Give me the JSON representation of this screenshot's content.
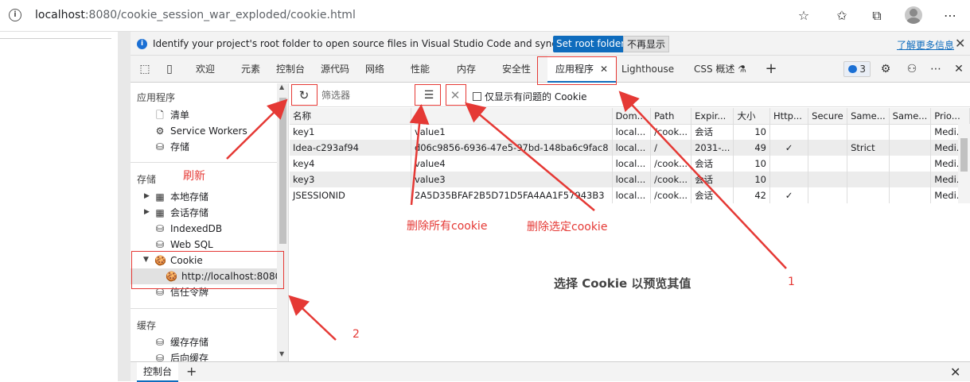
{
  "browser": {
    "url_host": "localhost",
    "url_path": ":8080/cookie_session_war_exploded/cookie.html"
  },
  "notice": {
    "text": "Identify your project's root folder to open source files in Visual Studio Code and sync changes.",
    "set_root_label": "Set root folder",
    "dismiss_label": "不再显示",
    "learn_more": "了解更多信息"
  },
  "tabs": {
    "welcome": "欢迎",
    "elements": "元素",
    "console": "控制台",
    "sources": "源代码",
    "network": "网络",
    "performance": "性能",
    "memory": "内存",
    "security": "安全性",
    "application": "应用程序",
    "lighthouse": "Lighthouse",
    "css_overview": "CSS 概述",
    "issues_count": "3"
  },
  "tree": {
    "app_section": "应用程序",
    "manifest": "清单",
    "service_workers": "Service Workers",
    "storage_item": "存储",
    "storage_section": "存储",
    "local_storage": "本地存储",
    "session_storage": "会话存储",
    "indexeddb": "IndexedDB",
    "websql": "Web SQL",
    "cookie": "Cookie",
    "cookie_origin": "http://localhost:8080",
    "trust_tokens": "信任令牌",
    "cache_section": "缓存",
    "cache_storage": "缓存存储",
    "back_forward_cache": "后向缓存"
  },
  "toolbar": {
    "filter_placeholder": "筛选器",
    "only_issues_label": "仅显示有问题的 Cookie"
  },
  "table": {
    "headers": [
      "名称",
      "值",
      "Dom...",
      "Path",
      "Expir...",
      "大小",
      "Http...",
      "Secure",
      "Same...",
      "Same...",
      "Prio..."
    ],
    "rows": [
      [
        "key1",
        "value1",
        "local...",
        "/cook...",
        "会话",
        "10",
        "",
        "",
        "",
        "",
        "Medi..."
      ],
      [
        "Idea-c293af94",
        "d06c9856-6936-47e5-97bd-148ba6c9fac8",
        "local...",
        "/",
        "2031-...",
        "49",
        "✓",
        "",
        "Strict",
        "",
        "Medi..."
      ],
      [
        "key4",
        "value4",
        "local...",
        "/cook...",
        "会话",
        "10",
        "",
        "",
        "",
        "",
        "Medi..."
      ],
      [
        "key3",
        "value3",
        "local...",
        "/cook...",
        "会话",
        "10",
        "",
        "",
        "",
        "",
        "Medi..."
      ],
      [
        "JSESSIONID",
        "2A5D35BFAF2B5D71D5FA4AA1F57943B3",
        "local...",
        "/cook...",
        "会话",
        "42",
        "✓",
        "",
        "",
        "",
        "Medi..."
      ]
    ]
  },
  "empty_hint": "选择 Cookie 以预览其值",
  "drawer": {
    "console_tab": "控制台"
  },
  "annotations": {
    "refresh": "刷新",
    "delete_all": "删除所有cookie",
    "delete_selected": "删除选定cookie",
    "num1": "1",
    "num2": "2",
    "color": "#e53935"
  }
}
